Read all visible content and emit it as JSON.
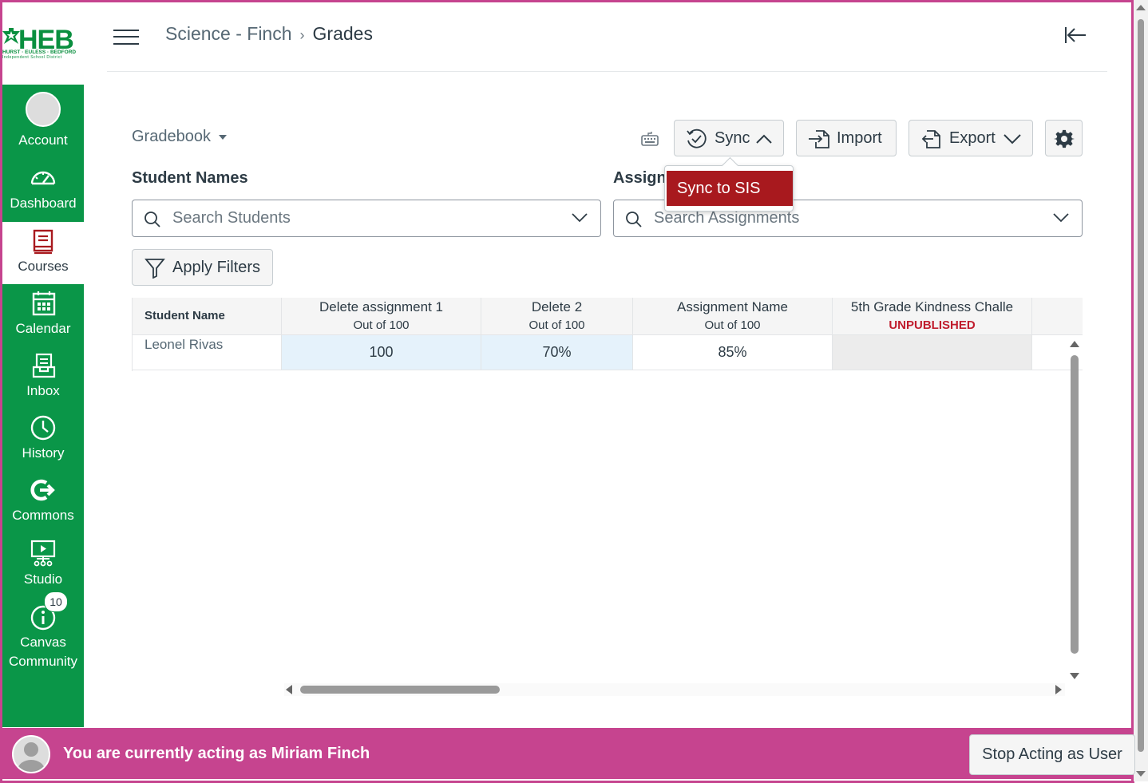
{
  "logo": {
    "letters": "HEB",
    "line1": "HURST · EULESS · BEDFORD",
    "line2": "Independent School District"
  },
  "nav": [
    {
      "label": "Account",
      "icon": "account-avatar"
    },
    {
      "label": "Dashboard",
      "icon": "dashboard-icon"
    },
    {
      "label": "Courses",
      "icon": "courses-icon",
      "active": true
    },
    {
      "label": "Calendar",
      "icon": "calendar-icon"
    },
    {
      "label": "Inbox",
      "icon": "inbox-icon"
    },
    {
      "label": "History",
      "icon": "history-icon"
    },
    {
      "label": "Commons",
      "icon": "commons-icon"
    },
    {
      "label": "Studio",
      "icon": "studio-icon"
    },
    {
      "label": "Canvas Community",
      "icon": "community-icon",
      "badge": "10"
    }
  ],
  "breadcrumb": {
    "course": "Science - Finch",
    "page": "Grades"
  },
  "toolbar": {
    "gradebook_menu": "Gradebook",
    "sync": "Sync",
    "import": "Import",
    "export": "Export",
    "sync_menu_item": "Sync to SIS"
  },
  "filters": {
    "students_label": "Student Names",
    "students_placeholder": "Search Students",
    "assignments_label": "Assignments",
    "assignments_placeholder": "Search Assignments",
    "apply": "Apply Filters"
  },
  "grid": {
    "student_header": "Student Name",
    "columns": [
      {
        "title": "Delete assignment 1",
        "sub": "Out of 100"
      },
      {
        "title": "Delete 2",
        "sub": "Out of 100"
      },
      {
        "title": "Assignment Name",
        "sub": "Out of 100"
      },
      {
        "title": "5th Grade Kindness Challe",
        "sub": "UNPUBLISHED"
      }
    ],
    "rows": [
      {
        "student": "Leonel Rivas",
        "grades": [
          "100",
          "70%",
          "85%",
          ""
        ]
      }
    ]
  },
  "acting": {
    "message": "You are currently acting as Miriam Finch",
    "stop": "Stop Acting as User"
  },
  "colors": {
    "nav": "#0a9648",
    "accent_bar": "#c6448f",
    "sync_item": "#a8191e",
    "unpublished": "#c01d2e"
  }
}
